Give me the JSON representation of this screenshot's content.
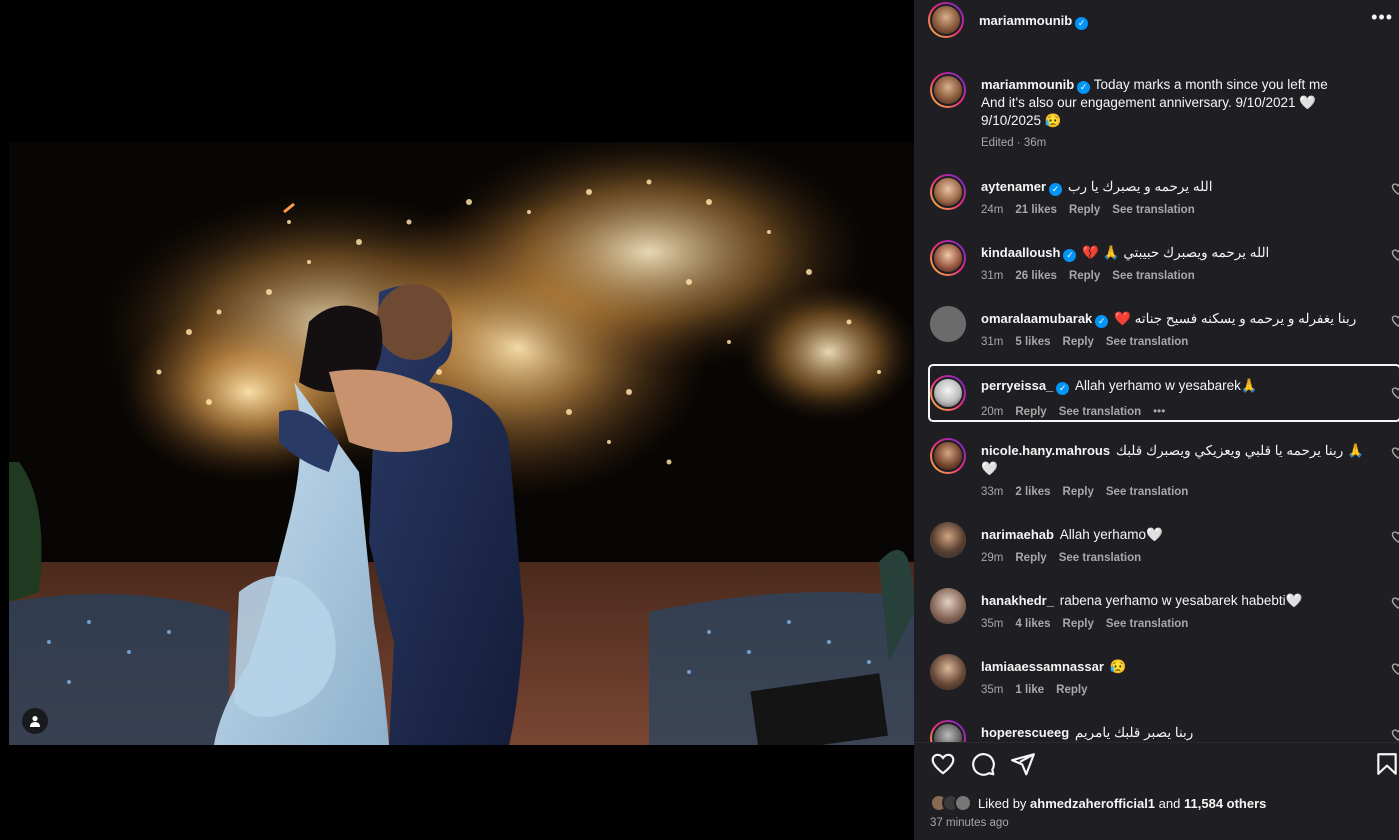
{
  "post": {
    "author": "mariammounib",
    "more_icon": "more-horizontal-icon",
    "caption_author": "mariammounib",
    "caption_text": "Today marks a month since you left me And it's also our engagement anniversary. 9/10/2021 🤍 9/10/2025 😥",
    "caption_meta": "Edited · 36m"
  },
  "comments": [
    {
      "user": "aytenamer",
      "verified": true,
      "text": "الله يرحمه و يصبرك يا رب",
      "time": "24m",
      "likes": "21 likes",
      "reply": "Reply",
      "translate": "See translation"
    },
    {
      "user": "kindaalloush",
      "verified": true,
      "text": "💔 🙏 الله يرحمه ويصبرك حبيبتي",
      "time": "31m",
      "likes": "26 likes",
      "reply": "Reply",
      "translate": "See translation"
    },
    {
      "user": "omaralaamubarak",
      "verified": true,
      "text": "❤️ ربنا يغفرله و يرحمه و يسكنه فسيح جناته",
      "time": "31m",
      "likes": "5 likes",
      "reply": "Reply",
      "translate": "See translation"
    },
    {
      "user": "perryeissa_",
      "verified": true,
      "text": "Allah yerhamo w yesabarek🙏",
      "time": "20m",
      "likes": "",
      "reply": "Reply",
      "translate": "See translation",
      "more": "•••"
    },
    {
      "user": "nicole.hany.mahrous",
      "verified": false,
      "text": "ربنا يرحمه يا قلبي ويعزيكي ويصبرك قلبك 🙏🤍",
      "time": "33m",
      "likes": "2 likes",
      "reply": "Reply",
      "translate": "See translation"
    },
    {
      "user": "narimaehab",
      "verified": false,
      "text": "Allah yerhamo🤍",
      "time": "29m",
      "likes": "",
      "reply": "Reply",
      "translate": "See translation"
    },
    {
      "user": "hanakhedr_",
      "verified": false,
      "text": "rabena yerhamo w yesabarek habebti🤍",
      "time": "35m",
      "likes": "4 likes",
      "reply": "Reply",
      "translate": "See translation"
    },
    {
      "user": "lamiaaessamnassar",
      "verified": false,
      "text": "😥",
      "time": "35m",
      "likes": "1 like",
      "reply": "Reply",
      "translate": ""
    },
    {
      "user": "hoperescueeg",
      "verified": false,
      "text": "ربنا يصبر قلبك يامريم",
      "time": "",
      "likes": "",
      "reply": "",
      "translate": ""
    }
  ],
  "actions": {
    "like_icon": "heart-icon",
    "comment_icon": "comment-icon",
    "share_icon": "send-icon",
    "save_icon": "bookmark-icon"
  },
  "likes": {
    "prefix": "Liked by",
    "user": "ahmedzaherofficial1",
    "and": "and",
    "count": "11,584 others"
  },
  "time_ago": "37 minutes ago",
  "colors": {
    "panel_bg": "#1f1f23",
    "verified": "#0095f6",
    "muted": "#a8a8a8"
  }
}
